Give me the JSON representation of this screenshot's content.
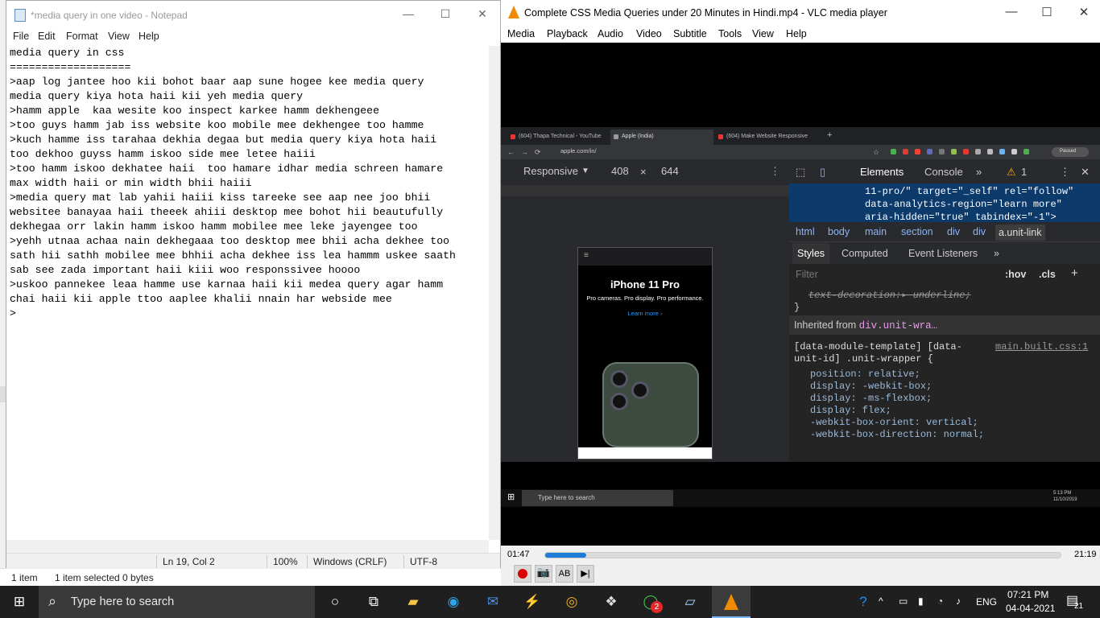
{
  "explorer": {
    "items": "1 item",
    "selected": "1 item selected  0 bytes"
  },
  "notepad": {
    "title": "*media query in one video - Notepad",
    "menu": [
      "File",
      "Edit",
      "Format",
      "View",
      "Help"
    ],
    "text": "media query in css\n===================\n>aap log jantee hoo kii bohot baar aap sune hogee kee media query\nmedia query kiya hota haii kii yeh media query\n>hamm apple  kaa wesite koo inspect karkee hamm dekhengeee\n>too guys hamm jab iss website koo mobile mee dekhengee too hamme\n>kuch hamme iss tarahaa dekhia degaa but media query kiya hota haii\ntoo dekhoo guyss hamm iskoo side mee letee haiii\n>too hamm iskoo dekhatee haii  too hamare idhar media schreen hamare\nmax width haii or min width bhii haiii\n>media query mat lab yahii haiii kiss tareeke see aap nee joo bhii\nwebsitee banayaa haii theeek ahiii desktop mee bohot hii beautufully\ndekhegaa orr lakin hamm iskoo hamm mobilee mee leke jayengee too\n>yehh utnaa achaa nain dekhegaaa too desktop mee bhii acha dekhee too\nsath hii sathh mobilee mee bhhii acha dekhee iss lea hammm uskee saath\nsab see zada important haii kiii woo responssivee hoooo\n>uskoo pannekee leaa hamme use karnaa haii kii medea query agar hamm\nchai haii kii apple ttoo aaplee khalii nnain har webside mee\n>",
    "status": {
      "pos": "Ln 19, Col 2",
      "zoom": "100%",
      "eol": "Windows (CRLF)",
      "enc": "UTF-8"
    }
  },
  "vlc": {
    "title": "Complete CSS Media Queries under 20 Minutes in Hindi.mp4 - VLC media player",
    "menu": [
      "Media",
      "Playback",
      "Audio",
      "Video",
      "Subtitle",
      "Tools",
      "View",
      "Help"
    ],
    "time_elapsed": "01:47",
    "time_total": "21:19",
    "progress": 0.08
  },
  "video": {
    "tabs": [
      "(604) Thapa Technical - YouTube",
      "Apple (India)",
      "(604) Make Website Responsive"
    ],
    "url": "apple.com/in/",
    "device": {
      "mode": "Responsive",
      "width": "408",
      "x": "×",
      "height": "644"
    },
    "phone": {
      "title": "iPhone 11 Pro",
      "subtitle": "Pro cameras. Pro display. Pro performance.",
      "link": "Learn more ›"
    },
    "devtools": {
      "tabs": [
        "Elements",
        "Console"
      ],
      "warn": "1",
      "html_lines": "11-pro/\" target=\"_self\" rel=\"follow\"\ndata-analytics-region=\"learn more\"\naria-hidden=\"true\" tabindex=\"-1\">",
      "crumbs": [
        "html",
        "body",
        "main",
        "section",
        "div",
        "div",
        "a.unit-link"
      ],
      "subtabs": [
        "Styles",
        "Computed",
        "Event Listeners"
      ],
      "filter": "Filter",
      "hov": ":hov",
      "cls": ".cls",
      "strike_line": "text-decoration:▸ underline;",
      "brace": "}",
      "inherited": "Inherited from",
      "inherited_from": "div.unit-wra…",
      "selector": "[data-module-template] [data-\nunit-id] .unit-wrapper {",
      "source": "main.built.css:1",
      "rules": "position: relative;\ndisplay: -webkit-box;\ndisplay: -ms-flexbox;\ndisplay: flex;\n-webkit-box-orient: vertical;\n-webkit-box-direction: normal;"
    },
    "taskbar": {
      "search": "Type here to search",
      "time": "5:13 PM",
      "date": "11/10/2019"
    }
  },
  "taskbar": {
    "search": "Type here to search",
    "lang": "ENG",
    "time": "07:21 PM",
    "date": "04-04-2021",
    "notif": "21",
    "whatsapp_badge": "2"
  }
}
